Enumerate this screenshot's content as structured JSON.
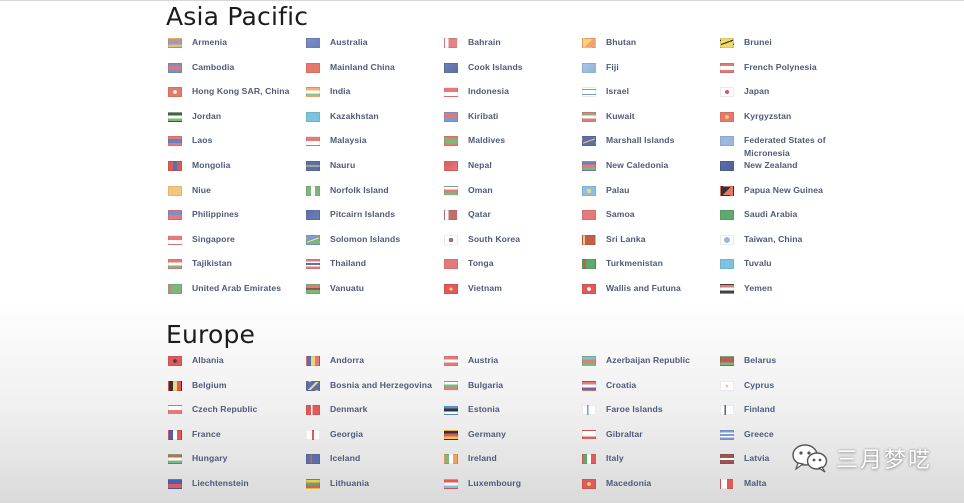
{
  "regions": [
    {
      "title": "Asia Pacific",
      "countries": [
        {
          "name": "Armenia",
          "flag": "linear-gradient(#d98a8a 0 33%, #8aa0d0 33% 66%, #e8c070 66%)"
        },
        {
          "name": "Australia",
          "flag": "linear-gradient(135deg, #7d8fc8, #6b7db8)"
        },
        {
          "name": "Bahrain",
          "flag": "linear-gradient(90deg, #fff 0 30%, #e08585 30%)"
        },
        {
          "name": "Bhutan",
          "flag": "linear-gradient(135deg, #f3d37e 0 50%, #f2a36c 50%)"
        },
        {
          "name": "Brunei",
          "flag": "linear-gradient(160deg, #f1d86a 0 40%, #333 40% 50%, #f1d86a 50%)"
        },
        {
          "name": "Cambodia",
          "flag": "linear-gradient(#7d8fc8 0 25%, #d97a7a 25% 75%, #7d8fc8 75%)"
        },
        {
          "name": "Mainland China",
          "flag": "linear-gradient(#e57a6b, #e57a6b)"
        },
        {
          "name": "Cook Islands",
          "flag": "linear-gradient(135deg, #6c7fb8, #5c6fa8)"
        },
        {
          "name": "Fiji",
          "flag": "linear-gradient(135deg, #a9c6e8, #8fb3dd)"
        },
        {
          "name": "French Polynesia",
          "flag": "linear-gradient(#e07a7a 0 25%, #fff 25% 75%, #e07a7a 75%)"
        },
        {
          "name": "Hong Kong SAR, China",
          "flag": "radial-gradient(circle, #fff 0 25%, #e57a6b 26%)"
        },
        {
          "name": "India",
          "flag": "linear-gradient(#f3b27a 0 33%, #fff 33% 66%, #8cc78c 66%)"
        },
        {
          "name": "Indonesia",
          "flag": "linear-gradient(#e57a7a 0 50%, #fff 50%)"
        },
        {
          "name": "Israel",
          "flag": "linear-gradient(#fff 0 15%, #7d9ad8 15% 25%, #fff 25% 75%, #7d9ad8 75% 85%, #fff 85%)"
        },
        {
          "name": "Japan",
          "flag": "radial-gradient(circle, #e05a5a 0 28%, #fff 30%)"
        },
        {
          "name": "Jordan",
          "flag": "linear-gradient(#555 0 33%, #fff 33% 66%, #7cb87c 66%)"
        },
        {
          "name": "Kazakhstan",
          "flag": "linear-gradient(#7cc3de, #7cc3de)"
        },
        {
          "name": "Kiribati",
          "flag": "linear-gradient(#e57a6b 0 55%, #7d9ad8 55%)"
        },
        {
          "name": "Kuwait",
          "flag": "linear-gradient(#7cb87c 0 33%, #fff 33% 66%, #e57a7a 66%)"
        },
        {
          "name": "Kyrgyzstan",
          "flag": "radial-gradient(circle, #f3d37e 0 25%, #e57a6b 26%)"
        },
        {
          "name": "Laos",
          "flag": "linear-gradient(#e57a7a 0 25%, #6f7fb8 25% 75%, #e57a7a 75%)"
        },
        {
          "name": "Malaysia",
          "flag": "linear-gradient(#e57a7a 0 50%, #fff 50%)"
        },
        {
          "name": "Maldives",
          "flag": "linear-gradient(#e57a6b 0 20%, #7cb87c 20% 80%, #e57a6b 80%)"
        },
        {
          "name": "Marshall Islands",
          "flag": "linear-gradient(160deg, #5c6fa8 0 45%, #f3b27a 45% 55%, #5c6fa8 55%)"
        },
        {
          "name": "Federated States of Micronesia",
          "flag": "linear-gradient(#9cb8e0, #9cb8e0)"
        },
        {
          "name": "Mongolia",
          "flag": "linear-gradient(90deg, #d85a5a 0 33%, #5c6fa8 33% 66%, #d85a5a 66%)"
        },
        {
          "name": "Nauru",
          "flag": "linear-gradient(#5c6fa8 0 45%, #f3d37e 45% 55%, #5c6fa8 55%)"
        },
        {
          "name": "Nepal",
          "flag": "linear-gradient(135deg, #e05a5a, #e57a7a)"
        },
        {
          "name": "New Caledonia",
          "flag": "linear-gradient(#6f7fb8 0 33%, #e57a7a 33% 66%, #7cb87c 66%)"
        },
        {
          "name": "New Zealand",
          "flag": "linear-gradient(135deg, #5c6fa8, #4c5f98)"
        },
        {
          "name": "Niue",
          "flag": "linear-gradient(#f3c77a, #f3c77a)"
        },
        {
          "name": "Norfolk Island",
          "flag": "linear-gradient(90deg, #7cb87c 0 33%, #fff 33% 66%, #7cb87c 66%)"
        },
        {
          "name": "Oman",
          "flag": "linear-gradient(#fff 0 33%, #e57a7a 33% 66%, #7cb87c 66%)"
        },
        {
          "name": "Palau",
          "flag": "radial-gradient(circle, #f3d37e 0 30%, #8cc0e0 32%)"
        },
        {
          "name": "Papua New Guinea",
          "flag": "linear-gradient(135deg, #333 0 50%, #e57a6b 50%)"
        },
        {
          "name": "Philippines",
          "flag": "linear-gradient(#7d8fc8 0 50%, #e57a7a 50%)"
        },
        {
          "name": "Pitcairn Islands",
          "flag": "linear-gradient(135deg, #5c6fa8, #6f7fb8)"
        },
        {
          "name": "Qatar",
          "flag": "linear-gradient(90deg, #fff 0 30%, #c0706b 30%)"
        },
        {
          "name": "Samoa",
          "flag": "linear-gradient(#e57a7a 0 100%)"
        },
        {
          "name": "Saudi Arabia",
          "flag": "linear-gradient(#5fa86f, #5fa86f)"
        },
        {
          "name": "Singapore",
          "flag": "linear-gradient(#e57a7a 0 50%, #fff 50%)"
        },
        {
          "name": "Solomon Islands",
          "flag": "linear-gradient(160deg, #7d9ad8 0 45%, #f3d37e 45% 55%, #7cb87c 55%)"
        },
        {
          "name": "South Korea",
          "flag": "radial-gradient(circle, #e05a5a 0 20%, #5c6fa8 22% 30%, #fff 32%)"
        },
        {
          "name": "Sri Lanka",
          "flag": "linear-gradient(90deg, #f3c77a 0 15%, #c0604b 15%)"
        },
        {
          "name": "Taiwan, China",
          "flag": "radial-gradient(circle, #9cb8e0 0 40%, #fff 42%)"
        },
        {
          "name": "Tajikistan",
          "flag": "linear-gradient(#e57a7a 0 33%, #fff 33% 66%, #7cb87c 66%)"
        },
        {
          "name": "Thailand",
          "flag": "linear-gradient(#e57a7a 0 20%, #fff 20% 35%, #5c6fa8 35% 65%, #fff 65% 80%, #e57a7a 80%)"
        },
        {
          "name": "Tonga",
          "flag": "linear-gradient(#e57a7a, #e57a7a)"
        },
        {
          "name": "Turkmenistan",
          "flag": "linear-gradient(90deg, #c0604b 0 25%, #5fa86f 25%)"
        },
        {
          "name": "Tuvalu",
          "flag": "linear-gradient(#7cc3de, #7cc3de)"
        },
        {
          "name": "United Arab Emirates",
          "flag": "linear-gradient(90deg, #e57a7a 0 25%, #7cb87c 25%)"
        },
        {
          "name": "Vanuatu",
          "flag": "linear-gradient(#e57a7a 0 45%, #333 45% 55%, #7cb87c 55%)"
        },
        {
          "name": "Vietnam",
          "flag": "radial-gradient(circle, #f3d37e 0 22%, #e05a5a 24%)"
        },
        {
          "name": "Wallis and Futuna",
          "flag": "radial-gradient(circle, #fff 0 25%, #e05a5a 27%)"
        },
        {
          "name": "Yemen",
          "flag": "linear-gradient(#e57a7a 0 33%, #fff 33% 66%, #444 66%)"
        }
      ]
    },
    {
      "title": "Europe",
      "countries": [
        {
          "name": "Albania",
          "flag": "radial-gradient(circle, #444 0 25%, #e05a5a 27%)"
        },
        {
          "name": "Andorra",
          "flag": "linear-gradient(90deg, #5c6fa8 0 33%, #f3d37e 33% 66%, #e57a7a 66%)"
        },
        {
          "name": "Austria",
          "flag": "linear-gradient(#e57a7a 0 33%, #fff 33% 66%, #e57a7a 66%)"
        },
        {
          "name": "Azerbaijan Republic",
          "flag": "linear-gradient(#7cc3de 0 33%, #e57a7a 33% 66%, #7cb87c 66%)"
        },
        {
          "name": "Belarus",
          "flag": "linear-gradient(#c05a5a 0 66%, #7cb87c 66%)"
        },
        {
          "name": "Belgium",
          "flag": "linear-gradient(90deg, #333 0 33%, #f3d37e 33% 66%, #e05a5a 66%)"
        },
        {
          "name": "Bosnia and Herzegovina",
          "flag": "linear-gradient(135deg, #5c6fa8 0 45%, #f3d37e 45% 60%, #5c6fa8 60%)"
        },
        {
          "name": "Bulgaria",
          "flag": "linear-gradient(#fff 0 33%, #7cb87c 33% 66%, #e57a7a 66%)"
        },
        {
          "name": "Croatia",
          "flag": "linear-gradient(#e57a7a 0 33%, #fff 33% 66%, #5c6fa8 66%)"
        },
        {
          "name": "Cyprus",
          "flag": "radial-gradient(circle, #f3c77a 0 18%, #fff 20%)"
        },
        {
          "name": "Czech Republic",
          "flag": "linear-gradient(#fff 0 50%, #e57a7a 50%)"
        },
        {
          "name": "Denmark",
          "flag": "linear-gradient(90deg, #e05a5a 0 35%, #fff 35% 45%, #e05a5a 45%)"
        },
        {
          "name": "Estonia",
          "flag": "linear-gradient(#5c8fd0 0 33%, #333 33% 66%, #fff 66%)"
        },
        {
          "name": "Faroe Islands",
          "flag": "linear-gradient(90deg, #fff 0 35%, #7d9ad8 35% 45%, #fff 45%)"
        },
        {
          "name": "Finland",
          "flag": "linear-gradient(90deg, #fff 0 30%, #4c5fb0 30% 42%, #fff 42%)"
        },
        {
          "name": "France",
          "flag": "linear-gradient(90deg, #4c5fb0 0 33%, #fff 33% 66%, #e05a5a 66%)"
        },
        {
          "name": "Georgia",
          "flag": "linear-gradient(90deg, #fff 0 42%, #e05a5a 42% 58%, #fff 58%)"
        },
        {
          "name": "Germany",
          "flag": "linear-gradient(#333 0 33%, #e05a5a 33% 66%, #f3c74a 66%)"
        },
        {
          "name": "Gibraltar",
          "flag": "linear-gradient(#fff 0 66%, #e05a5a 66%)"
        },
        {
          "name": "Greece",
          "flag": "linear-gradient(#7d9ad8 0 20%, #fff 20% 40%, #7d9ad8 40% 60%, #fff 60% 80%, #7d9ad8 80%)"
        },
        {
          "name": "Hungary",
          "flag": "linear-gradient(#e05a5a 0 33%, #fff 33% 66%, #7cb87c 66%)"
        },
        {
          "name": "Iceland",
          "flag": "linear-gradient(90deg, #5c6fa8 0 30%, #e05a5a 30% 42%, #5c6fa8 42%)"
        },
        {
          "name": "Ireland",
          "flag": "linear-gradient(90deg, #7cb87c 0 33%, #fff 33% 66%, #f3a35a 66%)"
        },
        {
          "name": "Italy",
          "flag": "linear-gradient(90deg, #5fa86f 0 33%, #fff 33% 66%, #e05a5a 66%)"
        },
        {
          "name": "Latvia",
          "flag": "linear-gradient(#a0525a 0 40%, #fff 40% 60%, #a0525a 60%)"
        },
        {
          "name": "Liechtenstein",
          "flag": "linear-gradient(#4c5fb0 0 50%, #e05a5a 50%)"
        },
        {
          "name": "Lithuania",
          "flag": "linear-gradient(#f3c74a 0 33%, #5fa86f 33% 66%, #e05a5a 66%)"
        },
        {
          "name": "Luxembourg",
          "flag": "linear-gradient(#e05a5a 0 33%, #fff 33% 66%, #7cc3de 66%)"
        },
        {
          "name": "Macedonia",
          "flag": "radial-gradient(circle, #f3d37e 0 25%, #e05a5a 27%)"
        },
        {
          "name": "Malta",
          "flag": "linear-gradient(90deg, #fff 0 50%, #e05a5a 50%)"
        }
      ]
    }
  ],
  "watermark": {
    "text": "三月梦呓",
    "icon": "wechat-icon"
  }
}
